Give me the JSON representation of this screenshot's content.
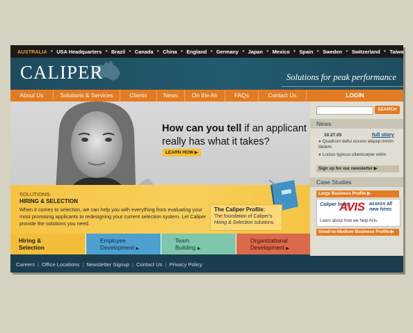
{
  "countries": [
    "AUSTRALIA",
    "USA Headquarters",
    "Brazil",
    "Canada",
    "China",
    "England",
    "Germany",
    "Japan",
    "Mexico",
    "Spain",
    "Sweden",
    "Switzerland",
    "Taiwan"
  ],
  "current_country": "AUSTRALIA",
  "brand": {
    "logo": "CALIPER",
    "tagline": "Solutions for peak performance"
  },
  "nav": [
    "About Us",
    "Solutions & Services",
    "Clients",
    "News",
    "On the Air",
    "FAQs",
    "Contact Us",
    "LOGIN"
  ],
  "hero": {
    "headline_bold": "How can you tell",
    "headline_rest1": " if an applicant",
    "headline_line2": "really has what it takes?",
    "learn_how": "LEARN HOW"
  },
  "solutions": {
    "label": "SOLUTIONS:",
    "title": "HIRING & SELECTION",
    "body": "When it comes to selection, we can help you with everything from evaluating your most promising applicants to redesigning your current selection system. Let Caliper provide the solutions you need."
  },
  "profile": {
    "title": "The Caliper Profile:",
    "body_pre": "The foundation of Caliper's",
    "body_em": "Hiring & Selection",
    "body_post": "solutions."
  },
  "tabs": [
    {
      "line1": "Hiring &",
      "line2": "Selection"
    },
    {
      "line1": "Employee",
      "line2": "Development"
    },
    {
      "line1": "Team",
      "line2": "Building"
    },
    {
      "line1": "Organizational",
      "line2": "Development"
    }
  ],
  "footer": [
    "Careers",
    "Office Locations",
    "Newsletter Signup",
    "Contact Us",
    "Privacy Policy"
  ],
  "sidebar": {
    "search_button": "SEARCH",
    "news_heading": "News",
    "news_date": "10.27.03",
    "full_story": "full story",
    "news_items": [
      "Quadrum defui occuro aliquip minim ibidem.",
      "Luctus typicus ullamcorper enim"
    ],
    "newsletter": "Sign up for our newsletter",
    "case_heading": "Case Studies",
    "large_business": "Large Business Profile",
    "avis": {
      "left": "Caliper helps",
      "logo": "AVIS",
      "right": "assess all new hires",
      "learn": "Learn about how we help Avis."
    },
    "small_business": "Small-to-Medium Business Profile"
  },
  "colors": {
    "accent": "#e37b22",
    "header": "#1f4b5e",
    "yellow": "#f5c444"
  }
}
